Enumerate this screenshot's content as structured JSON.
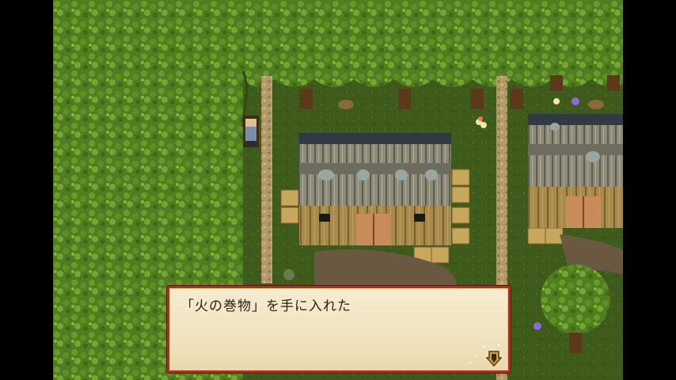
{
  "dialog": {
    "message": "「火の巻物」を手に入れた"
  },
  "icons": {
    "advance": "advance-arrow-icon"
  },
  "colors": {
    "forest": "#4e7a1e",
    "grass": "#3d5a1a",
    "dialog_border": "#a5321d",
    "dialog_bg": "#f3e7c6"
  }
}
